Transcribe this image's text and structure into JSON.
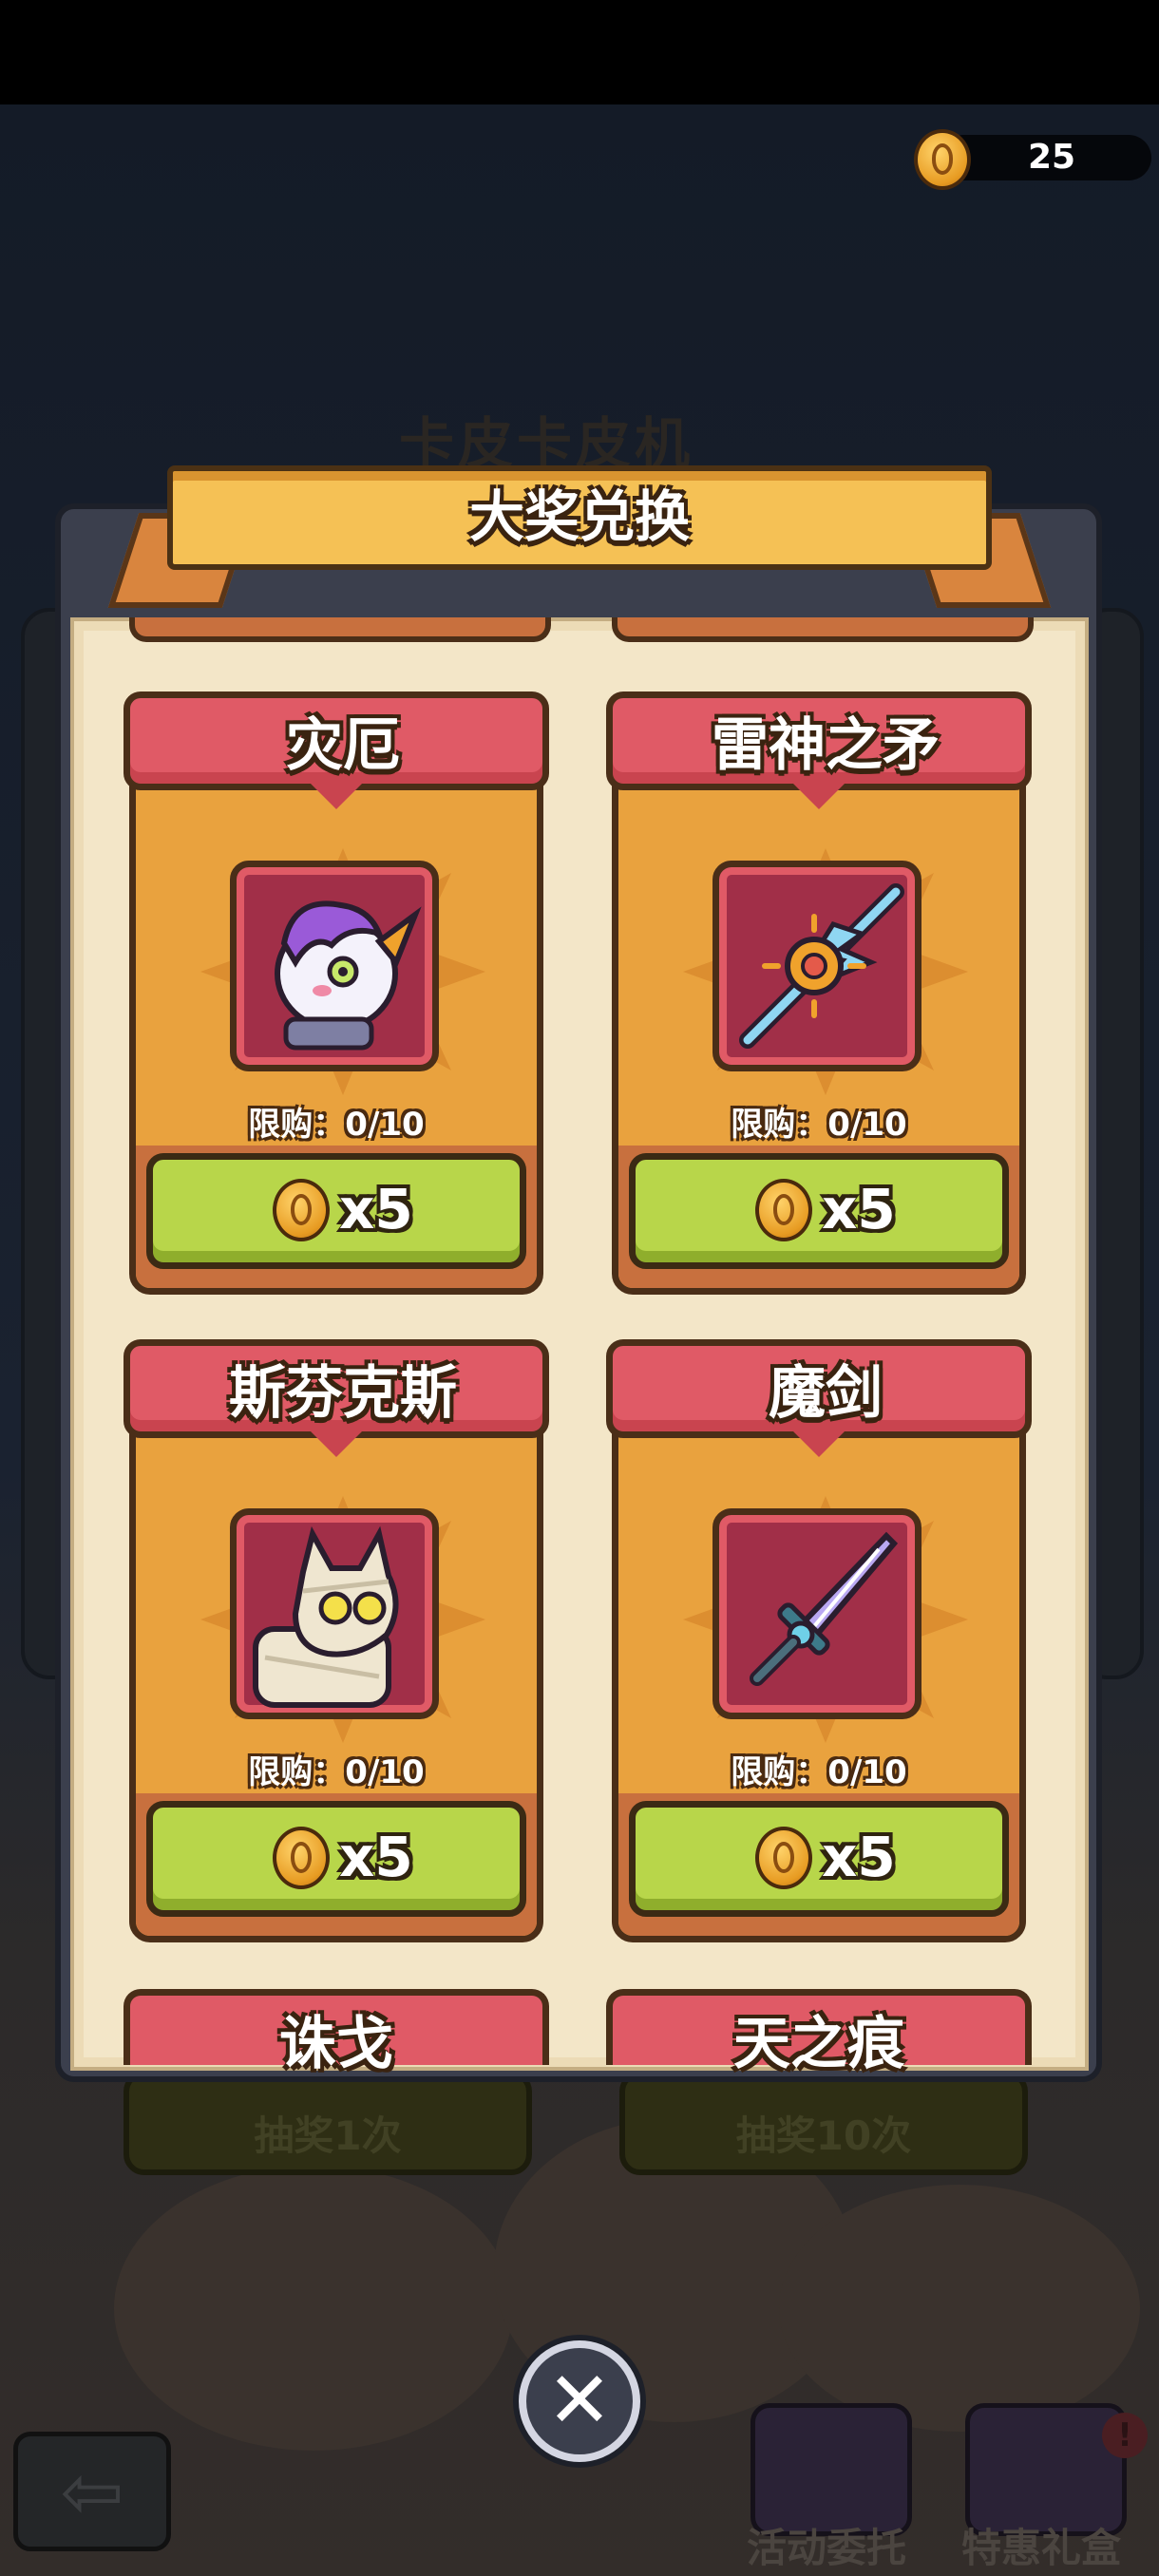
{
  "currency": {
    "icon": "coin-icon",
    "amount": "25"
  },
  "background": {
    "title": "卡皮卡皮机",
    "draw_once": "抽奖1次",
    "draw_ten": "抽奖10次",
    "bottom_left": "活动委托",
    "bottom_right": "特惠礼盒",
    "badge": "!"
  },
  "panel": {
    "title": "大奖兑换"
  },
  "rewards": [
    {
      "name": "灾厄",
      "limit": "限购：0/10",
      "price": "x5",
      "icon": "unicorn-icon"
    },
    {
      "name": "雷神之矛",
      "limit": "限购：0/10",
      "price": "x5",
      "icon": "lightning-spear-icon"
    },
    {
      "name": "斯芬克斯",
      "limit": "限购：0/10",
      "price": "x5",
      "icon": "mummy-cat-icon"
    },
    {
      "name": "魔剑",
      "limit": "限购：0/10",
      "price": "x5",
      "icon": "magic-sword-icon"
    },
    {
      "name": "诛戈"
    },
    {
      "name": "天之痕"
    }
  ],
  "colors": {
    "header": "#e05a66",
    "card": "#e9a23e",
    "buy": "#b8d64a",
    "ribbon": "#f5c155",
    "panel": "#3b3f4d"
  }
}
